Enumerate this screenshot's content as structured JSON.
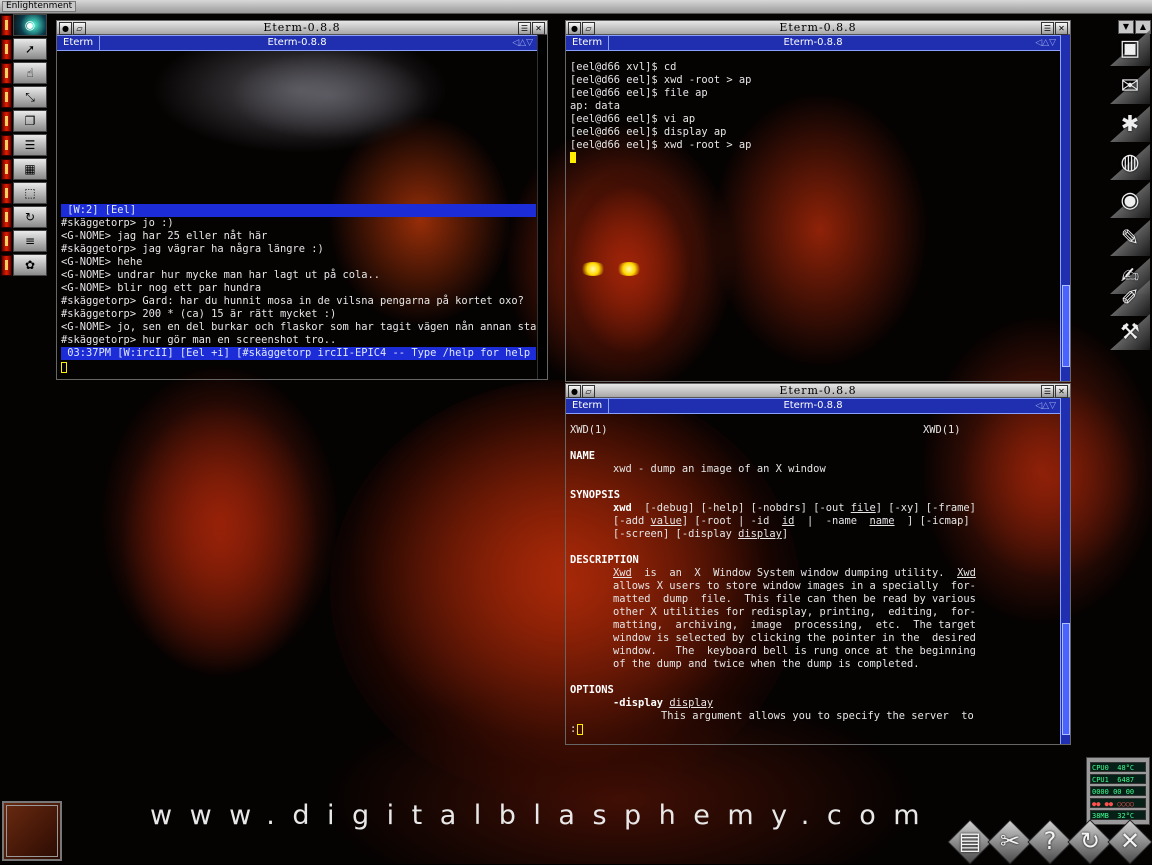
{
  "topbar": {
    "title": "Enlightenment",
    "arrow_up": "▲",
    "arrow_down": "▼"
  },
  "pager": {
    "items": [
      {
        "icon": "radar-icon",
        "glyph": "◉"
      },
      {
        "icon": "pointer-icon",
        "glyph": "➚"
      },
      {
        "icon": "menu-hand-icon",
        "glyph": "☝"
      },
      {
        "icon": "resize-icon",
        "glyph": "⤡"
      },
      {
        "icon": "windows-icon",
        "glyph": "❐"
      },
      {
        "icon": "bars-icon",
        "glyph": "☰"
      },
      {
        "icon": "desks-icon",
        "glyph": "▦"
      },
      {
        "icon": "cursor-box-icon",
        "glyph": "⬚"
      },
      {
        "icon": "refresh-icon",
        "glyph": "↻"
      },
      {
        "icon": "list-icon",
        "glyph": "≡"
      },
      {
        "icon": "gear-icon",
        "glyph": "✿"
      }
    ]
  },
  "right_icons": [
    {
      "icon": "terminal-icon",
      "glyph": "▣"
    },
    {
      "icon": "mail-icon",
      "glyph": "✉"
    },
    {
      "icon": "spider-icon",
      "glyph": "✱"
    },
    {
      "icon": "speaker-icon",
      "glyph": "◍"
    },
    {
      "icon": "eye-icon",
      "glyph": "◉"
    },
    {
      "icon": "pencil-icon",
      "glyph": "✎"
    },
    {
      "icon": "edit-icon",
      "glyph": "✍"
    },
    {
      "icon": "draw-icon",
      "glyph": "✐"
    },
    {
      "icon": "hammer-icon",
      "glyph": "⚒"
    }
  ],
  "windows": {
    "irc": {
      "title": "Eterm-0.8.8",
      "menu_label": "Eterm",
      "menu_title": "Eterm-0.8.8",
      "menu_arrows": "◁△▽",
      "header_bar": " [W:2] [Eel]",
      "lines": [
        "#skäggetorp> jo :)",
        "<G-NOME> jag har 25 eller nåt här",
        "#skäggetorp> jag vägrar ha några längre :)",
        "<G-NOME> hehe",
        "<G-NOME> undrar hur mycke man har lagt ut på cola..",
        "<G-NOME> blir nog ett par hundra",
        "#skäggetorp> Gard: har du hunnit mosa in de vilsna pengarna på kortet oxo?",
        "#skäggetorp> 200 * (ca) 15 är rätt mycket :)",
        "<G-NOME> jo, sen en del burkar och flaskor som har tagit vägen nån annan stans",
        "#skäggetorp> hur gör man en screenshot tro.."
      ],
      "status_bar": " 03:37PM [W:ircII] [Eel +i] [#skäggetorp ircII-EPIC4 -- Type /help for help ^^^"
    },
    "shell": {
      "title": "Eterm-0.8.8",
      "menu_label": "Eterm",
      "menu_title": "Eterm-0.8.8",
      "menu_arrows": "◁△▽",
      "lines": [
        "[eel@d66 xvl]$ cd",
        "[eel@d66 eel]$ xwd -root > ap",
        "[eel@d66 eel]$ file ap",
        "ap: data",
        "[eel@d66 eel]$ vi ap",
        "[eel@d66 eel]$ display ap",
        "[eel@d66 eel]$ xwd -root > ap"
      ]
    },
    "man": {
      "title": "Eterm-0.8.8",
      "menu_label": "Eterm",
      "menu_title": "Eterm-0.8.8",
      "menu_arrows": "◁△▽",
      "header_left": "XWD(1)",
      "header_right": "XWD(1)",
      "name_heading": "NAME",
      "name_text": "xwd - dump an image of an X window",
      "synopsis_heading": "SYNOPSIS",
      "synopsis_cmd": "xwd",
      "synopsis_1": "  [-debug] [-help] [-nobdrs] [-out ",
      "synopsis_file": "file",
      "synopsis_1b": "] [-xy] [-frame]",
      "synopsis_2a": "[-add ",
      "synopsis_value": "value",
      "synopsis_2b": "] [-root | -id  ",
      "synopsis_id": "id",
      "synopsis_2c": "  |  -name  ",
      "synopsis_name": "name",
      "synopsis_2d": "  ] [-icmap]",
      "synopsis_3a": "[-screen] [-display ",
      "synopsis_display": "display",
      "synopsis_3b": "]",
      "description_heading": "DESCRIPTION",
      "desc_xwd1": "Xwd",
      "desc_1": "  is  an  X  Window System window dumping utility.  ",
      "desc_xwd2": "Xwd",
      "desc_lines": [
        "allows X users to store window images in a specially  for-",
        "matted  dump  file.  This file can then be read by various",
        "other X utilities for redisplay, printing,  editing,  for-",
        "matting,  archiving,  image  processing,  etc.  The target",
        "window is selected by clicking the pointer in the  desired",
        "window.   The  keyboard bell is rung once at the beginning",
        "of the dump and twice when the dump is completed."
      ],
      "options_heading": "OPTIONS",
      "opt_flag": "-display ",
      "opt_arg": "display",
      "opt_text": "This argument allows you to specify the server  to",
      "prompt": ":"
    }
  },
  "monitors": {
    "rows": [
      "CPU0  48°C",
      "CPU1  6487",
      "0000 00 00",
      "●● ●● ○○○○",
      "38MB  32°C"
    ]
  },
  "wallpaper": {
    "url_text": "www.digitalblasphemy.com"
  },
  "bottom_icons": [
    {
      "icon": "files-icon",
      "glyph": "▤"
    },
    {
      "icon": "tools-icon",
      "glyph": "✂"
    },
    {
      "icon": "help-icon",
      "glyph": "?"
    },
    {
      "icon": "recycle-icon",
      "glyph": "↻"
    },
    {
      "icon": "exit-icon",
      "glyph": "✕"
    }
  ],
  "colors": {
    "menu_bar": "#1f2fb0",
    "highlight": "#1c2dd8",
    "cursor": "#ffee00",
    "text": "#e6e6e6"
  }
}
